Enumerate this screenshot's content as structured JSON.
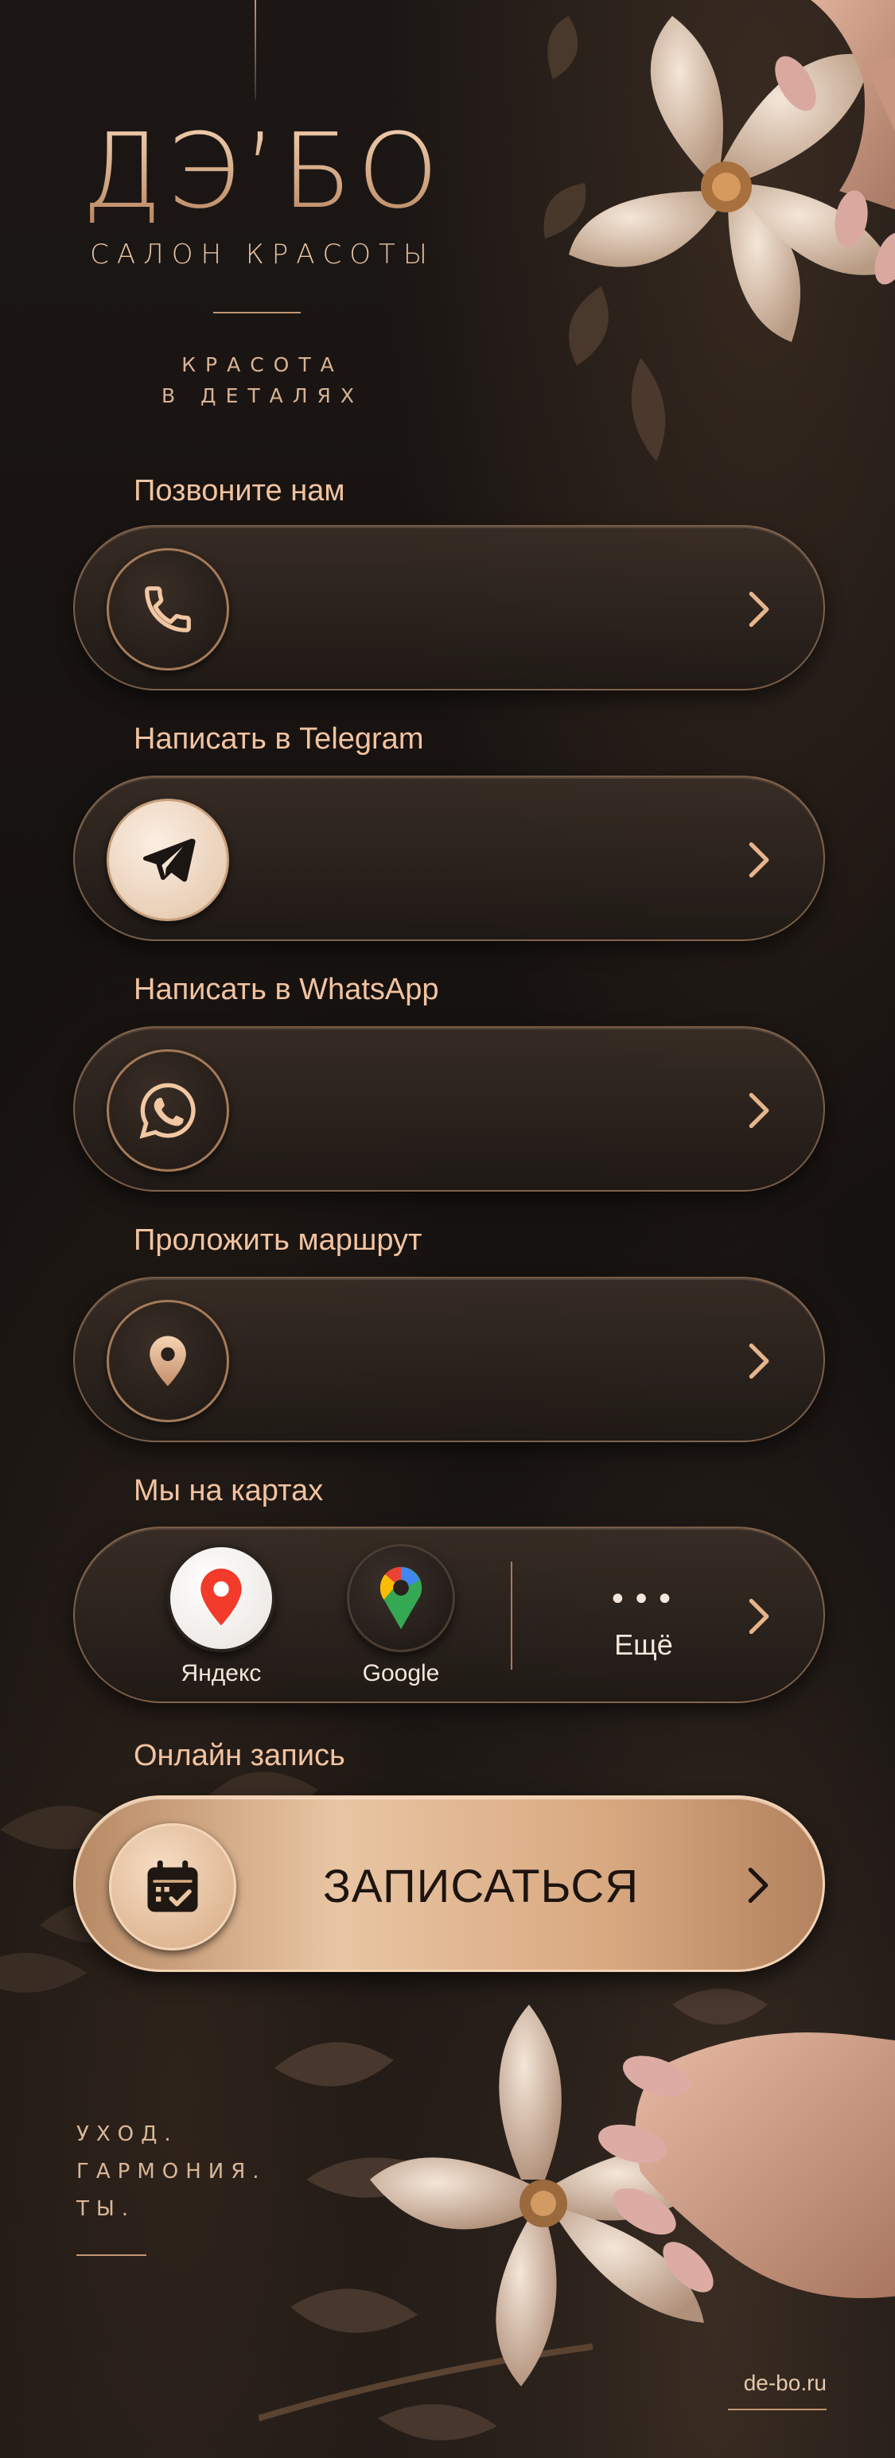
{
  "brand": {
    "logo": "ДЭ’БО",
    "subtitle": "САЛОН КРАСОТЫ",
    "tagline_line1": "КРАСОТА",
    "tagline_line2": "В ДЕТАЛЯХ"
  },
  "actions": [
    {
      "label": "Позвоните нам",
      "icon": "phone-icon"
    },
    {
      "label": "Написать в Telegram",
      "icon": "telegram-icon"
    },
    {
      "label": "Написать в WhatsApp",
      "icon": "whatsapp-icon"
    },
    {
      "label": "Проложить маршрут",
      "icon": "location-pin-icon"
    }
  ],
  "maps": {
    "label": "Мы на картах",
    "apps": [
      {
        "name": "Яндекс",
        "icon": "yandex-maps-icon"
      },
      {
        "name": "Google",
        "icon": "google-maps-icon"
      }
    ],
    "more_label": "Ещё",
    "more_dots": "•••"
  },
  "booking": {
    "label": "Онлайн запись",
    "button": "ЗАПИСАТЬСЯ",
    "icon": "calendar-check-icon"
  },
  "footer": {
    "motto_line1": "УХОД.",
    "motto_line2": "ГАРМОНИЯ.",
    "motto_line3": "ТЫ.",
    "website": "de-bo.ru"
  },
  "colors": {
    "accent_gold": "#d8a47c",
    "background": "#171311",
    "button_gradient_light": "#e9c5a3"
  }
}
